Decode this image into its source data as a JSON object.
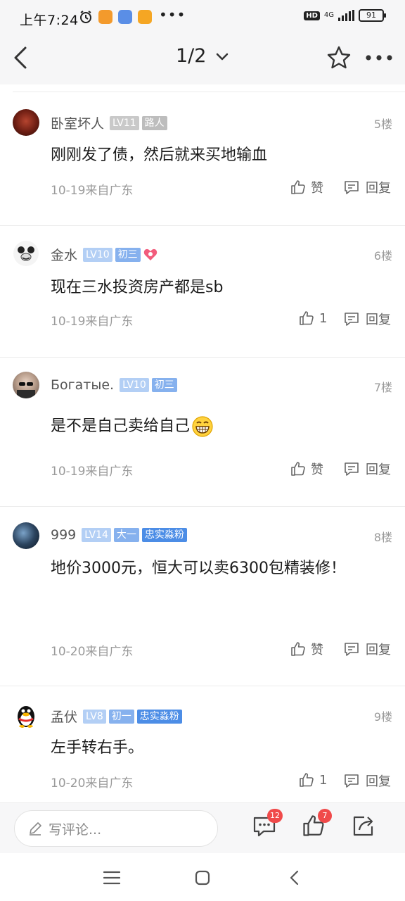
{
  "status_bar": {
    "time": "上午7:24",
    "hd": "HD",
    "network": "4G",
    "battery": "91"
  },
  "header": {
    "page_indicator": "1/2"
  },
  "comments": [
    {
      "username": "卧室坏人",
      "level": "LV11",
      "tags": [
        "路人"
      ],
      "floor": "5楼",
      "text": "刚刚发了债，然后就来买地输血",
      "meta": "10-19来自广东",
      "likes": "赞",
      "reply": "回复"
    },
    {
      "username": "金水",
      "level": "LV10",
      "tags": [
        "初三"
      ],
      "floor": "6楼",
      "text": "现在三水投资房产都是sb",
      "meta": "10-19来自广东",
      "likes": "1",
      "reply": "回复"
    },
    {
      "username": "Богатые.",
      "level": "LV10",
      "tags": [
        "初三"
      ],
      "floor": "7楼",
      "text": "是不是自己卖给自己",
      "meta": "10-19来自广东",
      "likes": "赞",
      "reply": "回复"
    },
    {
      "username": "999",
      "level": "LV14",
      "tags": [
        "大一",
        "忠实淼粉"
      ],
      "floor": "8楼",
      "text": "地价3000元，恒大可以卖6300包精装修！",
      "meta": "10-20来自广东",
      "likes": "赞",
      "reply": "回复"
    },
    {
      "username": "孟伏",
      "level": "LV8",
      "tags": [
        "初一",
        "忠实淼粉"
      ],
      "floor": "9楼",
      "text": "左手转右手。",
      "meta": "10-20来自广东",
      "likes": "1",
      "reply": "回复"
    }
  ],
  "bottom_bar": {
    "comment_placeholder": "写评论...",
    "comment_count": "12",
    "like_count": "7"
  },
  "colors": {
    "badge_red": "#f04a4a",
    "level_blue": "#b3cff5",
    "fan_tag": "#4c8de6"
  }
}
